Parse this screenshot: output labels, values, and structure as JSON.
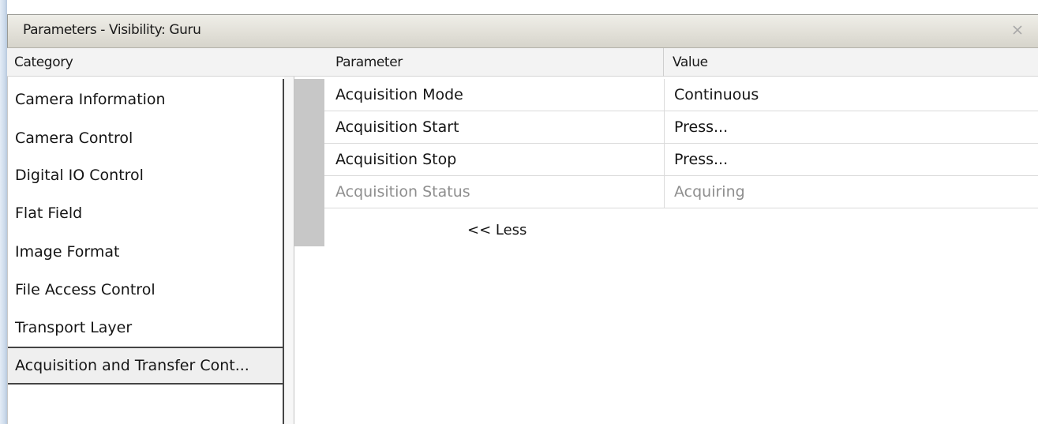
{
  "window": {
    "title": "Parameters - Visibility: Guru",
    "close_symbol": "×"
  },
  "headers": {
    "category": "Category",
    "parameter": "Parameter",
    "value": "Value"
  },
  "categories": [
    {
      "label": "Camera Information"
    },
    {
      "label": "Camera Control"
    },
    {
      "label": "Digital IO Control"
    },
    {
      "label": "Flat Field"
    },
    {
      "label": "Image Format"
    },
    {
      "label": "File Access Control"
    },
    {
      "label": "Transport Layer"
    },
    {
      "label": "Acquisition and Transfer Cont...",
      "selected": true
    }
  ],
  "parameters": [
    {
      "name": "Acquisition Mode",
      "value": "Continuous",
      "enabled": true
    },
    {
      "name": "Acquisition Start",
      "value": "Press...",
      "enabled": true
    },
    {
      "name": "Acquisition Stop",
      "value": "Press...",
      "enabled": true
    },
    {
      "name": "Acquisition Status",
      "value": "Acquiring",
      "enabled": false
    }
  ],
  "less_link": "<< Less",
  "icons": {
    "close": "close-icon"
  },
  "colors": {
    "disabled_text": "#8e8e8e",
    "selection_border": "#454545",
    "row_header": "#c7c7c7"
  }
}
